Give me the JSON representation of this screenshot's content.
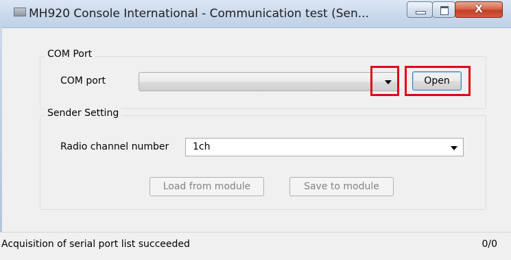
{
  "window": {
    "title": "MH920 Console International - Communication test (Sen...",
    "close_glyph": "X"
  },
  "com_port_group": {
    "legend": "COM Port",
    "com_port_label": "COM port",
    "com_port_value": "",
    "open_button": "Open"
  },
  "sender_group": {
    "legend": "Sender Setting",
    "channel_label": "Radio channel number",
    "channel_value": "1ch",
    "load_button": "Load from module",
    "save_button": "Save to module"
  },
  "status_bar": {
    "message": "Acquisition of serial port list succeeded",
    "count": "0/0"
  },
  "colors": {
    "highlight_red": "#e0001a",
    "window_bg": "#f0f0f0",
    "close_button": "#c2402a"
  },
  "icons": [
    "app-icon",
    "minimize-icon",
    "maximize-icon",
    "close-icon",
    "dropdown-arrow-icon"
  ]
}
